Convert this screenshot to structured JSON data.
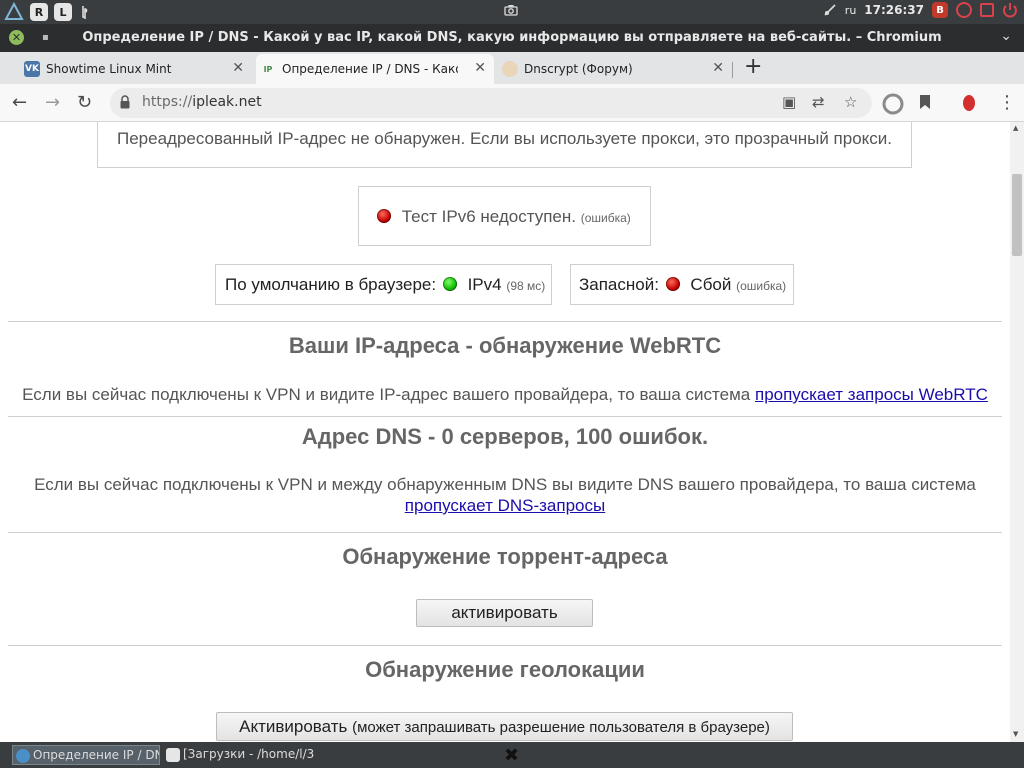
{
  "system_panel": {
    "badges": [
      "R",
      "L"
    ],
    "keyboard_layout": "ru",
    "clock": "17:26:37",
    "tray_badge": "B"
  },
  "window": {
    "title": "Определение IP / DNS - Какой у вас IP, какой DNS, какую информацию вы отправляете на веб-сайты. – Chromium"
  },
  "tabs": [
    {
      "label": "Showtime Linux Mint",
      "favicon": "VK"
    },
    {
      "label": "Определение IP / DNS - Какой",
      "favicon": "IP"
    },
    {
      "label": "Dnscrypt (Форум)",
      "favicon": ""
    }
  ],
  "toolbar": {
    "url_scheme": "https://",
    "url_host": "ipleak.net"
  },
  "page": {
    "forwarded_ip_text": "Переадресованный IP-адрес не обнаружен. Если вы используете прокси, это прозрачный прокси.",
    "ipv6_test": {
      "text": "Тест IPv6 недоступен.",
      "note": "(ошибка)",
      "status_color": "#c10000"
    },
    "default_browser": {
      "label": "По умолчанию в браузере:",
      "value": "IPv4",
      "note": "(98 мс)",
      "status_color": "#10b800"
    },
    "fallback": {
      "label": "Запасной:",
      "value": "Сбой",
      "note": "(ошибка)",
      "status_color": "#c10000"
    },
    "webrtc": {
      "heading": "Ваши IP-адреса - обнаружение WebRTC",
      "text": "Если вы сейчас подключены к VPN и видите IP-адрес вашего провайдера, то ваша система",
      "link": "пропускает запросы WebRTC"
    },
    "dns": {
      "heading": "Адрес DNS - 0 серверов, 100 ошибок.",
      "text": "Если вы сейчас подключены к VPN и между обнаруженным DNS вы видите DNS вашего провайдера, то ваша система",
      "link": "пропускает DNS-запросы"
    },
    "torrent": {
      "heading": "Обнаружение торрент-адреса",
      "button": "активировать"
    },
    "geolocation": {
      "heading": "Обнаружение геолокации",
      "button_main": "Активировать",
      "button_note": "(может запрашивать разрешение пользователя в браузере)"
    }
  },
  "taskbar": {
    "items": [
      {
        "label": "Определение IP / DN..."
      },
      {
        "label": "[Загрузки - /home/l/3..."
      }
    ]
  }
}
